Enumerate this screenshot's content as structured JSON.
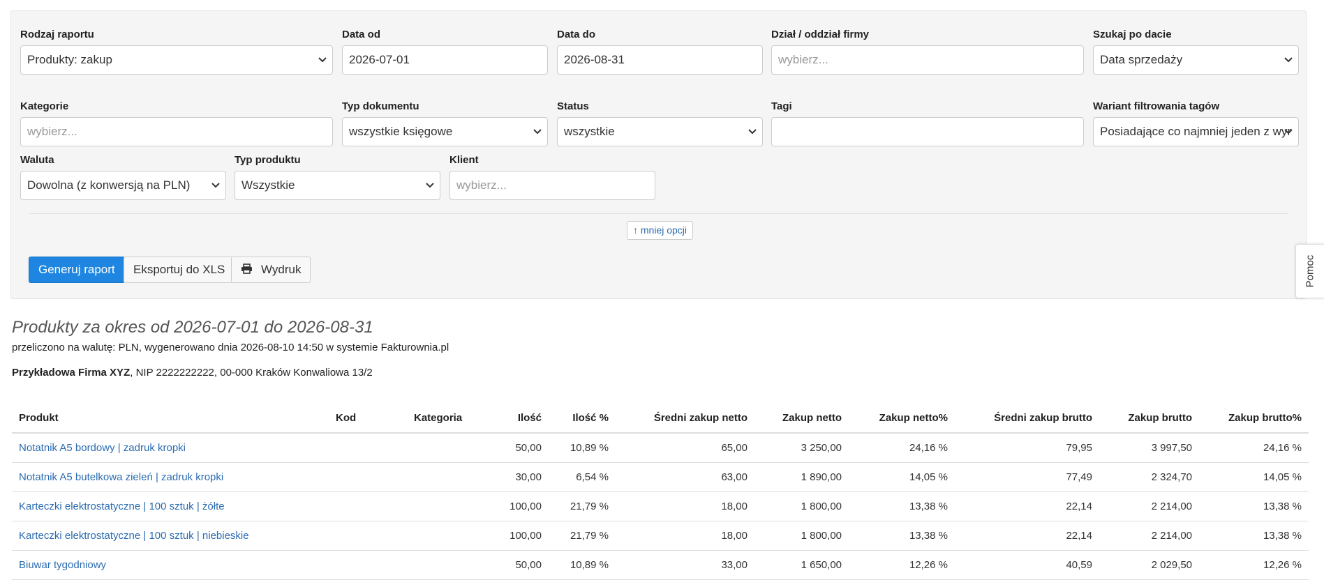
{
  "filters": {
    "report_type": {
      "label": "Rodzaj raportu",
      "value": "Produkty: zakup"
    },
    "date_from": {
      "label": "Data od",
      "value": "2026-07-01"
    },
    "date_to": {
      "label": "Data do",
      "value": "2026-08-31"
    },
    "department": {
      "label": "Dział / oddział firmy",
      "placeholder": "wybierz..."
    },
    "search_by_date": {
      "label": "Szukaj po dacie",
      "value": "Data sprzedaży"
    },
    "categories": {
      "label": "Kategorie",
      "placeholder": "wybierz..."
    },
    "doc_type": {
      "label": "Typ dokumentu",
      "value": "wszystkie księgowe"
    },
    "status": {
      "label": "Status",
      "value": "wszystkie"
    },
    "tags": {
      "label": "Tagi",
      "value": ""
    },
    "tag_filter": {
      "label": "Wariant filtrowania tagów",
      "value": "Posiadające co najmniej jeden z wyr"
    },
    "currency": {
      "label": "Waluta",
      "value": "Dowolna (z konwersją na PLN)"
    },
    "product_type": {
      "label": "Typ produktu",
      "value": "Wszystkie"
    },
    "client": {
      "label": "Klient",
      "placeholder": "wybierz..."
    }
  },
  "less_options": "↑ mniej opcji",
  "buttons": {
    "generate": "Generuj raport",
    "export": "Eksportuj do XLS",
    "print": "Wydruk"
  },
  "help_tab": "Pomoc",
  "report": {
    "title": "Produkty za okres od 2026-07-01 do 2026-08-31",
    "subtitle": "przeliczono na walutę: PLN, wygenerowano dnia 2026-08-10 14:50 w systemie Fakturownia.pl",
    "company_name": "Przykładowa Firma XYZ",
    "company_details": ", NIP 2222222222, 00-000 Kraków Konwaliowa 13/2"
  },
  "table": {
    "headers": [
      "Produkt",
      "Kod",
      "Kategoria",
      "Ilość",
      "Ilość %",
      "Średni zakup netto",
      "Zakup netto",
      "Zakup netto%",
      "Średni zakup brutto",
      "Zakup brutto",
      "Zakup brutto%"
    ],
    "rows": [
      [
        "Notatnik A5 bordowy | zadruk kropki",
        "",
        "",
        "50,00",
        "10,89 %",
        "65,00",
        "3 250,00",
        "24,16 %",
        "79,95",
        "3 997,50",
        "24,16 %"
      ],
      [
        "Notatnik A5 butelkowa zieleń | zadruk kropki",
        "",
        "",
        "30,00",
        "6,54 %",
        "63,00",
        "1 890,00",
        "14,05 %",
        "77,49",
        "2 324,70",
        "14,05 %"
      ],
      [
        "Karteczki elektrostatyczne | 100 sztuk | żółte",
        "",
        "",
        "100,00",
        "21,79 %",
        "18,00",
        "1 800,00",
        "13,38 %",
        "22,14",
        "2 214,00",
        "13,38 %"
      ],
      [
        "Karteczki elektrostatyczne | 100 sztuk | niebieskie",
        "",
        "",
        "100,00",
        "21,79 %",
        "18,00",
        "1 800,00",
        "13,38 %",
        "22,14",
        "2 214,00",
        "13,38 %"
      ],
      [
        "Biuwar tygodniowy",
        "",
        "",
        "50,00",
        "10,89 %",
        "33,00",
        "1 650,00",
        "12,26 %",
        "40,59",
        "2 029,50",
        "12,26 %"
      ]
    ]
  },
  "colors": {
    "primary": "#1e86e0",
    "link": "#2a6bb0",
    "panel": "#f5f5f5"
  }
}
